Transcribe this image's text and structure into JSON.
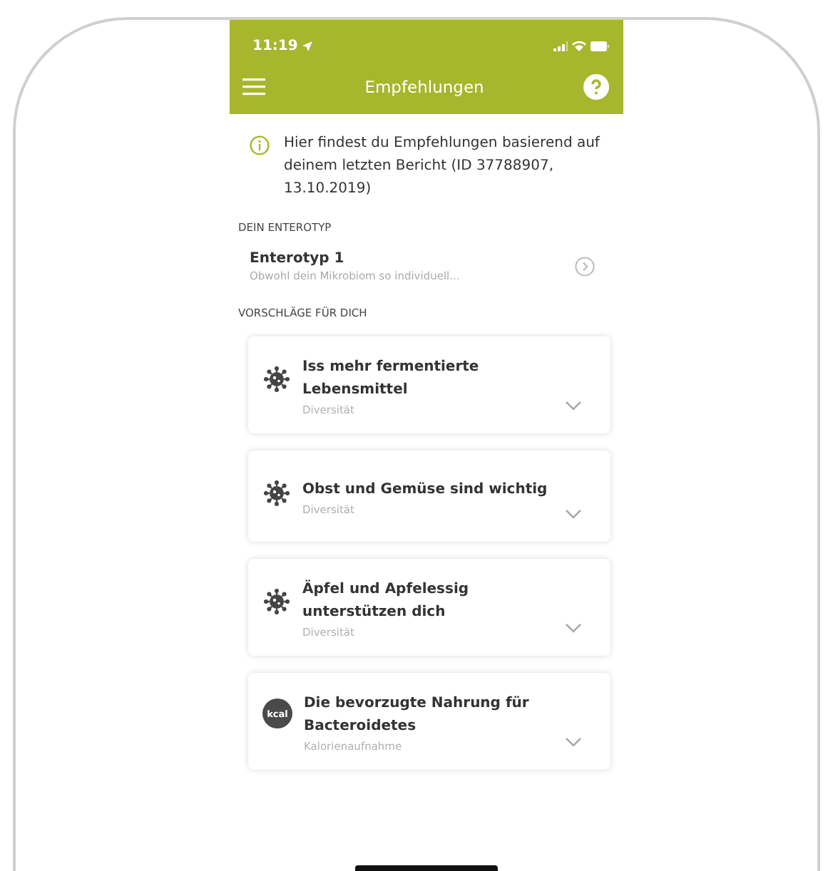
{
  "status_bar": {
    "time": "11:19"
  },
  "nav_bar": {
    "title": "Empfehlungen"
  },
  "info": {
    "text": "Hier findest du Empfehlungen basierend auf deinem letzten Bericht (ID 37788907, 13.10.2019)"
  },
  "enterotype_section": {
    "heading": "DEIN ENTEROTYP",
    "title": "Enterotyp 1",
    "subtitle": "Obwohl dein Mikrobiom so individuell..."
  },
  "suggestions_section": {
    "heading": "VORSCHLÄGE FÜR DICH",
    "cards": [
      {
        "kind": "germ",
        "title": "Iss mehr fermentierte Lebensmittel",
        "category": "Diversität",
        "expanded": false
      },
      {
        "kind": "germ",
        "title": "Obst und Gemüse sind wichtig",
        "category": "Diversität",
        "expanded": false
      },
      {
        "kind": "germ",
        "title": "Äpfel und Apfelessig unterstützen dich",
        "category": "Diversität",
        "expanded": false
      },
      {
        "kind": "kcal",
        "icon_text": "kcal",
        "title": "Die bevorzugte Nahrung für Bacteroidetes",
        "category": "Kalorienaufnahme",
        "expanded": false
      }
    ]
  }
}
